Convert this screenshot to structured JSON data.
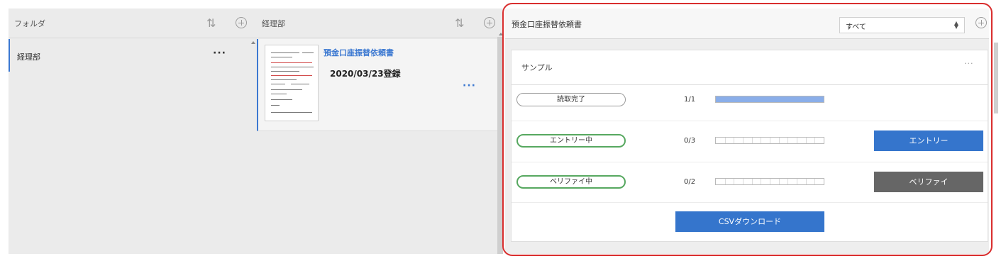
{
  "folders": {
    "title": "フォルダ",
    "sort_icon": "sort-arrows-icon",
    "add_icon": "plus-circle-icon",
    "items": [
      {
        "label": "経理部",
        "more": "···"
      }
    ]
  },
  "documents": {
    "title": "経理部",
    "sort_icon": "sort-arrows-icon",
    "add_icon": "plus-circle-icon",
    "items": [
      {
        "name": "預金口座振替依頼書",
        "date": "2020/03/23登録",
        "more": "···"
      }
    ]
  },
  "detail": {
    "title": "預金口座振替依頼書",
    "filter": {
      "selected": "すべて",
      "arrow": "⬍"
    },
    "add_icon": "plus-circle-icon",
    "card": {
      "title": "サンプル",
      "more": "···",
      "rows": [
        {
          "status": "読取完了",
          "count": "1/1",
          "progress": 1.0,
          "segments": 1,
          "action": null
        },
        {
          "status": "エントリー中",
          "count": "0/3",
          "progress": 0,
          "segments": 12,
          "action": "エントリー"
        },
        {
          "status": "ベリファイ中",
          "count": "0/2",
          "progress": 0,
          "segments": 12,
          "action": "ベリファイ"
        }
      ],
      "csv_label": "CSVダウンロード"
    }
  },
  "colors": {
    "accent": "#3b78d1",
    "button_blue": "#3575cc",
    "button_gray": "#666666",
    "status_green": "#57a860",
    "progress_fill": "#8aaee9",
    "highlight_red": "#d92e2e"
  }
}
